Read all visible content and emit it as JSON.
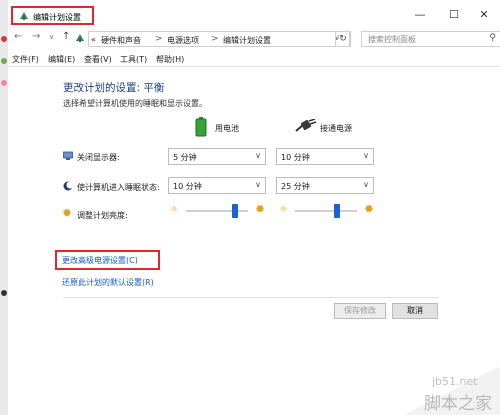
{
  "window": {
    "title": "编辑计划设置",
    "controls": {
      "minimize": "—",
      "maximize": "☐",
      "close": "✕"
    }
  },
  "address": {
    "prefix": "«",
    "crumbs": [
      "硬件和声音",
      "电源选项",
      "编辑计划设置"
    ],
    "separator": ">",
    "search_placeholder": "搜索控制面板"
  },
  "menu": [
    "文件(F)",
    "编辑(E)",
    "查看(V)",
    "工具(T)",
    "帮助(H)"
  ],
  "content": {
    "title": "更改计划的设置: 平衡",
    "subtitle": "选择希望计算机使用的睡眠和显示设置。",
    "columns": {
      "battery": "用电池",
      "plugged": "接通电源"
    },
    "rows": {
      "display_off": {
        "label": "关闭显示器:",
        "battery": "5 分钟",
        "plugged": "10 分钟"
      },
      "sleep": {
        "label": "使计算机进入睡眠状态:",
        "battery": "10 分钟",
        "plugged": "25 分钟"
      },
      "brightness": {
        "label": "调整计划亮度:",
        "battery_level": 0.83,
        "plugged_level": 0.7
      }
    },
    "links": {
      "advanced": "更改高级电源设置(C)",
      "restore": "还原此计划的默认设置(R)"
    },
    "buttons": {
      "save": "保存修改",
      "cancel": "取消"
    }
  },
  "watermark": {
    "line1": "jb51.net",
    "line2": "脚本之家"
  },
  "colors": {
    "highlight": "#e02a2a",
    "title_blue": "#1e3f8a",
    "link": "#1559c5",
    "slider": "#1a62d0"
  }
}
